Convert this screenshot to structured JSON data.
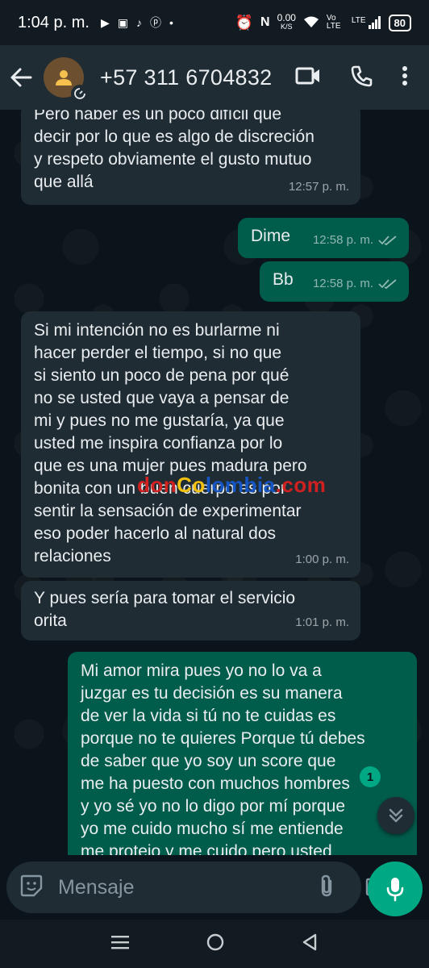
{
  "status_bar": {
    "time": "1:04 p. m.",
    "network_speed": "0.00",
    "network_unit": "K/S",
    "network_type": "LTE",
    "volte": "Vo LTE",
    "battery": "80"
  },
  "header": {
    "contact": "+57 311 6704832"
  },
  "messages": [
    {
      "direction": "in",
      "text": "Pero haber es un poco difícil que\ndecir por lo que es algo de discreción\ny respeto obviamente el gusto mutuo\nque allá",
      "time": "12:57 p. m."
    },
    {
      "direction": "out",
      "text": "Dime",
      "time": "12:58 p. m.",
      "status": "read"
    },
    {
      "direction": "out",
      "text": "Bb",
      "time": "12:58 p. m.",
      "status": "read"
    },
    {
      "direction": "in",
      "text": "Si mi intención no es burlarme ni\nhacer perder el tiempo, si no que\nsi siento un poco de pena por qué\nno se usted que vaya a pensar de\nmi y pues no me gustaría, ya que\nusted me inspira confianza por lo\nque es una mujer pues madura pero\nbonita con un buen cuerpo es por\nsentir la sensación de experimentar\neso poder hacerlo al natural dos\nrelaciones",
      "time": "1:00 p. m."
    },
    {
      "direction": "in",
      "text": "Y pues sería para tomar el servicio\norita",
      "time": "1:01 p. m."
    },
    {
      "direction": "out",
      "text": "Mi amor mira pues yo no lo va a\njuzgar es tu decisión es su manera\nde ver la vida si tú no te cuidas es\nporque no te quieres Porque tú debes\nde saber que yo soy un score que\nme ha puesto con muchos hombres\ny yo sé yo no lo digo por mí porque\nyo me cuido mucho sí me entiende\nme protejo y me cuido pero usted",
      "time": ""
    }
  ],
  "watermark": {
    "part1": "don",
    "part2": "Co",
    "part3": "lombia",
    "part4": ".com"
  },
  "unread_count": "1",
  "composer": {
    "placeholder": "Mensaje"
  },
  "colors": {
    "incoming_bubble": "#1f2c34",
    "outgoing_bubble": "#005c4b",
    "accent": "#00a884",
    "read_ticks": "#8696a0"
  }
}
